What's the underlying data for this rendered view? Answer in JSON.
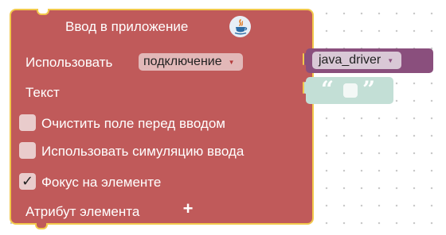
{
  "block": {
    "title": "Ввод в приложение",
    "icon": "java-icon",
    "rows": {
      "use_label": "Использовать",
      "use_value": "подключение",
      "text_label": "Текст",
      "attribute_label": "Атрибут элемента"
    },
    "checkboxes": [
      {
        "label": "Очистить поле перед вводом",
        "checked": false,
        "mark": ""
      },
      {
        "label": "Использовать симуляцию ввода",
        "checked": false,
        "mark": ""
      },
      {
        "label": "Фокус на элементе",
        "checked": true,
        "mark": "✓"
      }
    ],
    "add_symbol": "+"
  },
  "connection_block": {
    "value": "java_driver"
  },
  "text_block": {
    "open_quote": "“",
    "close_quote": "”",
    "value": ""
  },
  "caret": "▼",
  "colors": {
    "block": "#c05a5a",
    "block_border": "#f2c94c",
    "connection_block": "#8a4f7d",
    "text_block": "#c3dfd6"
  }
}
